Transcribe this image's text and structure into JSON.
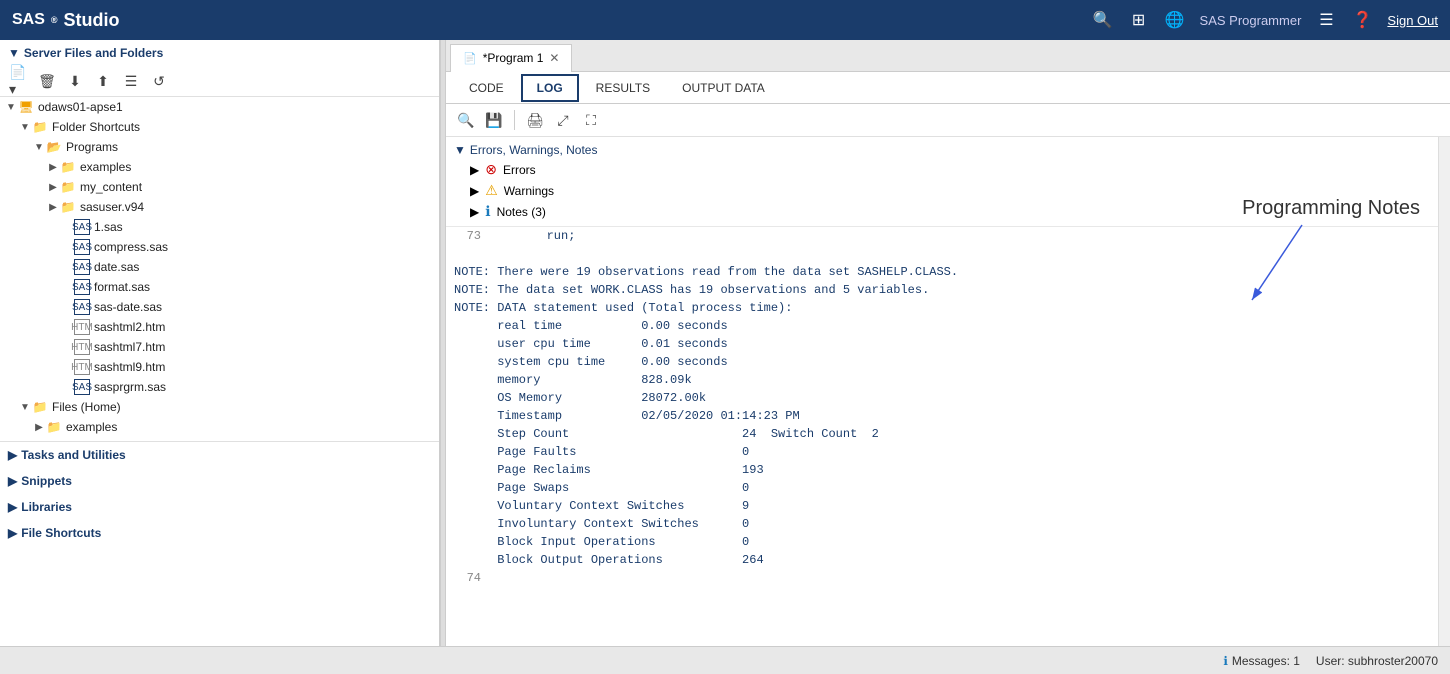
{
  "app": {
    "title": "SAS® Studio",
    "sas_label": "SAS",
    "studio_label": "Studio"
  },
  "header": {
    "icons": [
      "search",
      "grid",
      "globe"
    ],
    "user": "SAS Programmer",
    "signout": "Sign Out"
  },
  "sidebar": {
    "section_label": "Server Files and Folders",
    "toolbar_icons": [
      "new",
      "delete",
      "download",
      "upload",
      "properties",
      "refresh"
    ],
    "tree": [
      {
        "level": 0,
        "arrow": "▼",
        "icon": "server",
        "label": "odaws01-apse1",
        "type": "server"
      },
      {
        "level": 1,
        "arrow": "▼",
        "icon": "folder-shortcuts",
        "label": "Folder Shortcuts",
        "type": "folder"
      },
      {
        "level": 2,
        "arrow": "▼",
        "icon": "programs",
        "label": "Programs",
        "type": "folder"
      },
      {
        "level": 3,
        "arrow": "▶",
        "icon": "folder",
        "label": "examples",
        "type": "folder"
      },
      {
        "level": 3,
        "arrow": "▶",
        "icon": "folder",
        "label": "my_content",
        "type": "folder"
      },
      {
        "level": 3,
        "arrow": "▶",
        "icon": "folder",
        "label": "sasuser.v94",
        "type": "folder"
      },
      {
        "level": 3,
        "arrow": "",
        "icon": "sas-file",
        "label": "1.sas",
        "type": "file"
      },
      {
        "level": 3,
        "arrow": "",
        "icon": "sas-file",
        "label": "compress.sas",
        "type": "file"
      },
      {
        "level": 3,
        "arrow": "",
        "icon": "sas-file",
        "label": "date.sas",
        "type": "file"
      },
      {
        "level": 3,
        "arrow": "",
        "icon": "sas-file",
        "label": "format.sas",
        "type": "file"
      },
      {
        "level": 3,
        "arrow": "",
        "icon": "sas-file",
        "label": "sas-date.sas",
        "type": "file"
      },
      {
        "level": 3,
        "arrow": "",
        "icon": "htm-file",
        "label": "sashtml2.htm",
        "type": "htm"
      },
      {
        "level": 3,
        "arrow": "",
        "icon": "htm-file",
        "label": "sashtml7.htm",
        "type": "htm"
      },
      {
        "level": 3,
        "arrow": "",
        "icon": "htm-file",
        "label": "sashtml9.htm",
        "type": "htm"
      },
      {
        "level": 3,
        "arrow": "",
        "icon": "sas-file",
        "label": "sasprgrm.sas",
        "type": "file"
      },
      {
        "level": 1,
        "arrow": "▼",
        "icon": "folder",
        "label": "Files (Home)",
        "type": "folder"
      },
      {
        "level": 2,
        "arrow": "▶",
        "icon": "folder",
        "label": "examples",
        "type": "folder"
      }
    ],
    "collapsed_items": [
      {
        "label": "Tasks and Utilities",
        "arrow": "▶"
      },
      {
        "label": "Snippets",
        "arrow": "▶"
      },
      {
        "label": "Libraries",
        "arrow": "▶"
      },
      {
        "label": "File Shortcuts",
        "arrow": "▶"
      }
    ]
  },
  "tabs": [
    {
      "label": "*Program 1",
      "active": true,
      "icon": "📄"
    }
  ],
  "sub_tabs": [
    {
      "label": "CODE",
      "active": false
    },
    {
      "label": "LOG",
      "active": true
    },
    {
      "label": "RESULTS",
      "active": false
    },
    {
      "label": "OUTPUT DATA",
      "active": false
    }
  ],
  "log_toolbar": {
    "icons": [
      "filter",
      "save",
      "print",
      "expand",
      "fullscreen"
    ]
  },
  "ewn": {
    "header": "Errors, Warnings, Notes",
    "items": [
      {
        "type": "error",
        "label": "Errors"
      },
      {
        "type": "warning",
        "label": "Warnings"
      },
      {
        "type": "info",
        "label": "Notes (3)"
      }
    ]
  },
  "log_lines": [
    {
      "num": "73",
      "code": "        run;"
    },
    {
      "num": "",
      "code": ""
    }
  ],
  "notes_content": [
    "NOTE: There were 19 observations read from the data set SASHELP.CLASS.",
    "NOTE: The data set WORK.CLASS has 19 observations and 5 variables.",
    "NOTE: DATA statement used (Total process time):",
    "      real time           0.00 seconds",
    "      user cpu time       0.01 seconds",
    "      system cpu time     0.00 seconds",
    "      memory              828.09k",
    "      OS Memory           28072.00k",
    "      Timestamp           02/05/2020 01:14:23 PM",
    "      Step Count                        24  Switch Count  2",
    "      Page Faults                       0",
    "      Page Reclaims                     193",
    "      Page Swaps                        0",
    "      Voluntary Context Switches        9",
    "      Involuntary Context Switches      0",
    "      Block Input Operations            0",
    "      Block Output Operations           264"
  ],
  "line_74": "74",
  "annotation": {
    "label": "Programming Notes"
  },
  "status_bar": {
    "messages_icon": "ℹ",
    "messages_label": "Messages: 1",
    "user_label": "User: subhroster20070"
  }
}
